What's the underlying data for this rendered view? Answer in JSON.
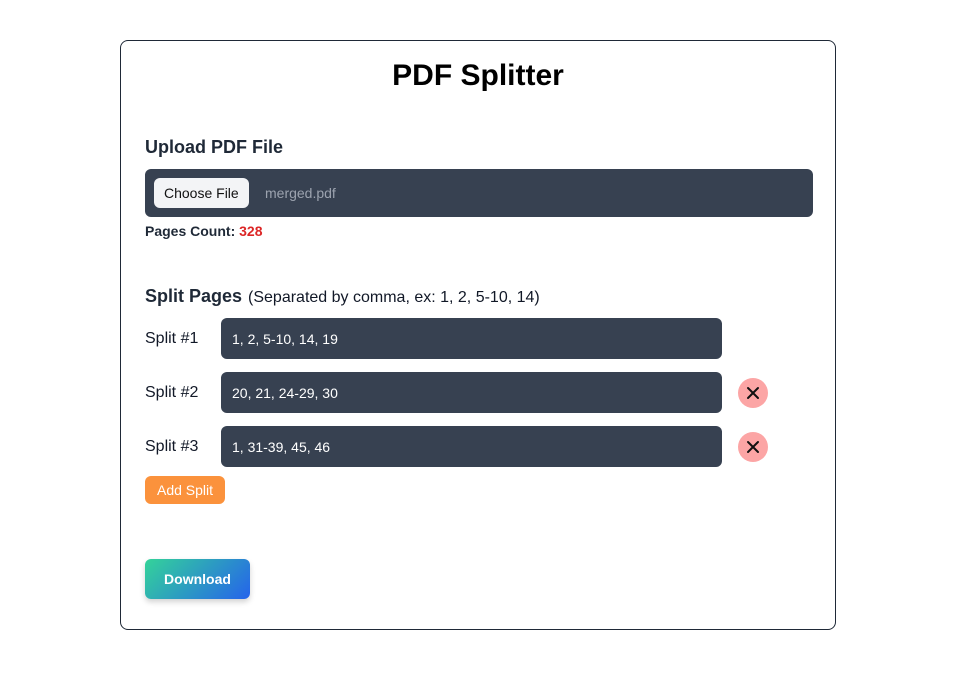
{
  "title": "PDF Splitter",
  "upload": {
    "label": "Upload PDF File",
    "choose_button": "Choose File",
    "file_name": "merged.pdf",
    "pages_count_label": "Pages Count:",
    "pages_count_value": "328"
  },
  "split": {
    "heading": "Split Pages",
    "hint": "(Separated by comma, ex: 1, 2, 5-10, 14)",
    "rows": [
      {
        "label": "Split #1",
        "value": "1, 2, 5-10, 14, 19"
      },
      {
        "label": "Split #2",
        "value": "20, 21, 24-29, 30"
      },
      {
        "label": "Split #3",
        "value": "1, 31-39, 45, 46"
      }
    ],
    "add_button": "Add Split"
  },
  "download_button": "Download",
  "icons": {
    "remove": "close-icon"
  },
  "colors": {
    "field_bg": "#374151",
    "accent_orange": "#fb923c",
    "remove_bg": "#fca5a5",
    "count_red": "#dc2626",
    "gradient_start": "#34d399",
    "gradient_end": "#2563eb"
  }
}
